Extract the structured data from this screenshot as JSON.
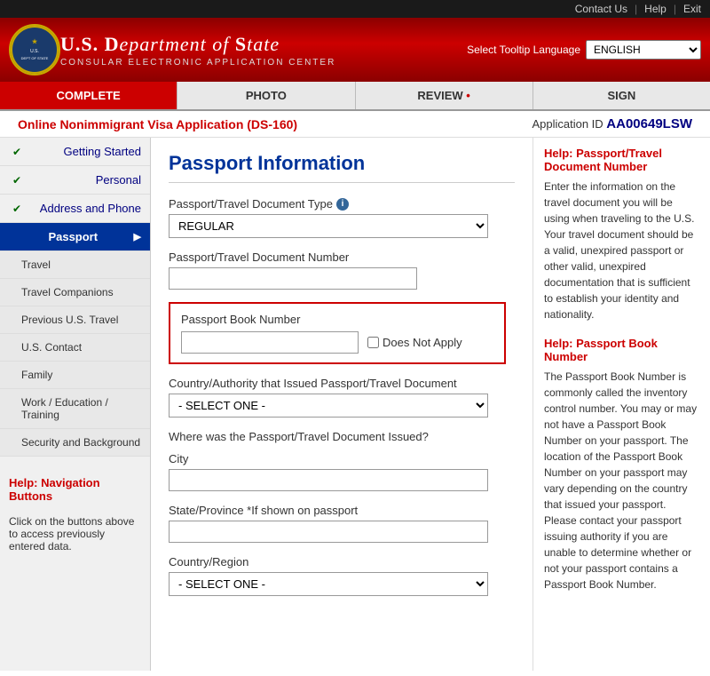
{
  "topbar": {
    "contact_us": "Contact Us",
    "help": "Help",
    "exit": "Exit"
  },
  "header": {
    "dept_line1": "U.S. D",
    "dept_name": "U.S. Department",
    "dept_of": "of",
    "dept_state": "State",
    "subtitle": "CONSULAR ELECTRONIC APPLICATION CENTER",
    "tooltip_label": "Select Tooltip Language",
    "lang_value": "ENGLISH"
  },
  "tabs": [
    {
      "id": "complete",
      "label": "COMPLETE",
      "active": true
    },
    {
      "id": "photo",
      "label": "PHOTO",
      "active": false
    },
    {
      "id": "review",
      "label": "REVIEW",
      "dot": true,
      "active": false
    },
    {
      "id": "sign",
      "label": "SIGN",
      "active": false
    }
  ],
  "app_bar": {
    "form_name": "Online Nonimmigrant Visa Application (DS-160)",
    "app_id_label": "Application ID",
    "app_id_value": "AA00649LSW"
  },
  "sidebar": {
    "items": [
      {
        "id": "getting-started",
        "label": "Getting Started",
        "completed": true
      },
      {
        "id": "personal",
        "label": "Personal",
        "completed": true
      },
      {
        "id": "address-phone",
        "label": "Address and Phone",
        "completed": true
      },
      {
        "id": "passport",
        "label": "Passport",
        "active": true,
        "sub": true
      },
      {
        "id": "travel",
        "label": "Travel",
        "sub": true
      },
      {
        "id": "travel-companions",
        "label": "Travel Companions",
        "sub": true
      },
      {
        "id": "previous-us-travel",
        "label": "Previous U.S. Travel",
        "sub": true
      },
      {
        "id": "us-contact",
        "label": "U.S. Contact",
        "sub": true
      },
      {
        "id": "family",
        "label": "Family",
        "sub": true
      },
      {
        "id": "work-education",
        "label": "Work / Education / Training",
        "sub": true
      },
      {
        "id": "security-background",
        "label": "Security and Background",
        "sub": true
      }
    ],
    "help": {
      "title": "Help: Navigation Buttons",
      "text": "Click on the buttons above to access previously entered data."
    }
  },
  "page": {
    "title": "Passport Information"
  },
  "form": {
    "passport_type_label": "Passport/Travel Document Type",
    "passport_type_info": "i",
    "passport_type_value": "REGULAR",
    "passport_number_label": "Passport/Travel Document Number",
    "passport_book_label": "Passport Book Number",
    "does_not_apply": "Does Not Apply",
    "issued_country_label": "Country/Authority that Issued Passport/Travel Document",
    "issued_country_placeholder": "- SELECT ONE -",
    "issued_where_label": "Where was the Passport/Travel Document Issued?",
    "city_label": "City",
    "state_province_label": "State/Province *If shown on passport",
    "country_region_label": "Country/Region",
    "country_region_placeholder": "- SELECT ONE -"
  },
  "help_panel": {
    "section1_heading": "Help: Passport/Travel Document Number",
    "section1_text": "Enter the information on the travel document you will be using when traveling to the U.S. Your travel document should be a valid, unexpired passport or other valid, unexpired documentation that is sufficient to establish your identity and nationality.",
    "section2_heading": "Help: Passport Book Number",
    "section2_text": "The Passport Book Number is commonly called the inventory control number. You may or may not have a Passport Book Number on your passport. The location of the Passport Book Number on your passport may vary depending on the country that issued your passport. Please contact your passport issuing authority if you are unable to determine whether or not your passport contains a Passport Book Number."
  }
}
